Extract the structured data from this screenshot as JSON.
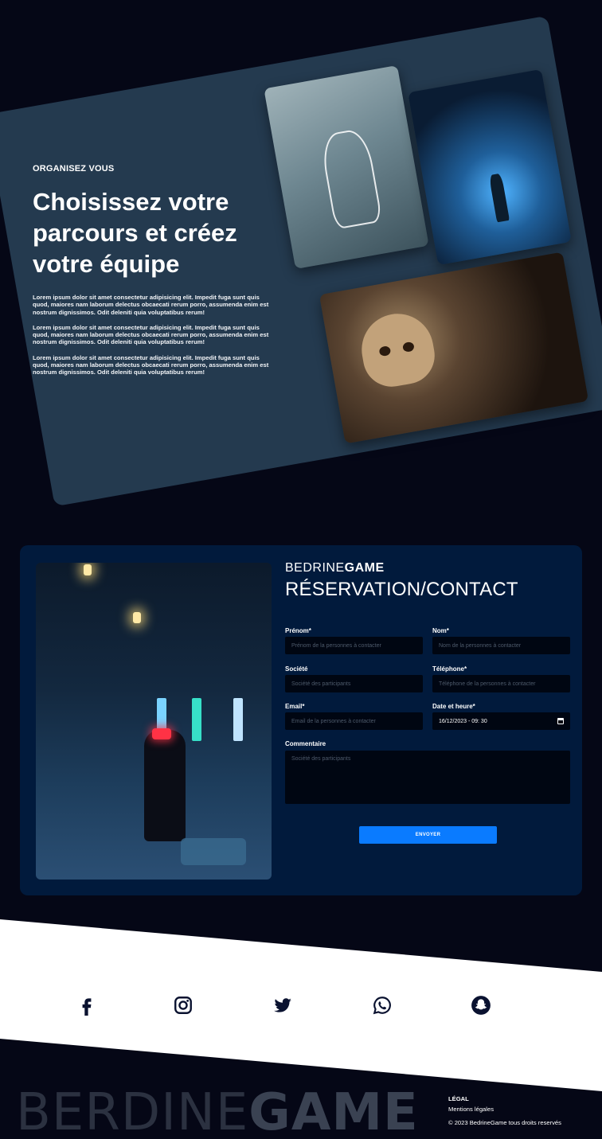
{
  "hero": {
    "eyebrow": "ORGANISEZ VOUS",
    "title": "Choisissez votre parcours et créez votre équipe",
    "paragraphs": [
      "Lorem ipsum dolor sit amet consectetur adipisicing elit. Impedit fuga sunt quis quod, maiores nam laborum delectus obcaecati rerum porro, assumenda enim est nostrum dignissimos. Odit deleniti quia voluptatibus rerum!",
      "Lorem ipsum dolor sit amet consectetur adipisicing elit. Impedit fuga sunt quis quod, maiores nam laborum delectus obcaecati rerum porro, assumenda enim est nostrum dignissimos. Odit deleniti quia voluptatibus rerum!",
      "Lorem ipsum dolor sit amet consectetur adipisicing elit. Impedit fuga sunt quis quod, maiores nam laborum delectus obcaecati rerum porro, assumenda enim est nostrum dignissimos. Odit deleniti quia voluptatibus rerum!"
    ]
  },
  "reservation": {
    "brand_light": "BEDRINE",
    "brand_bold": "GAME",
    "title": "RÉSERVATION/CONTACT",
    "fields": {
      "prenom": {
        "label": "Prénom*",
        "placeholder": "Prénom de la personnes à contacter"
      },
      "nom": {
        "label": "Nom*",
        "placeholder": "Nom de la personnes à contacter"
      },
      "societe": {
        "label": "Société",
        "placeholder": "Société des participants"
      },
      "telephone": {
        "label": "Téléphone*",
        "placeholder": "Téléphone de la personnes à contacter"
      },
      "email": {
        "label": "Email*",
        "placeholder": "Email de la personnes à contacter"
      },
      "date": {
        "label": "Date et heure*",
        "value": "16/12/2023 -  09: 30"
      },
      "commentaire": {
        "label": "Commentaire",
        "placeholder": "Société des participants"
      }
    },
    "submit_label": "ENVOYER"
  },
  "social": {
    "icons": [
      "facebook-icon",
      "instagram-icon",
      "twitter-icon",
      "whatsapp-icon",
      "snapchat-icon"
    ]
  },
  "footer": {
    "brand_light": "BERDINE",
    "brand_bold": "GAME",
    "legal_heading": "LÉGAL",
    "legal_link": "Mentions légales",
    "copyright": "© 2023 BedrineGame tous droits reservés"
  },
  "colors": {
    "page_bg": "#050716",
    "hero_card": "#243a4f",
    "reservation_bg": "#011a3c",
    "input_bg": "#000612",
    "button": "#0a7bff",
    "social_icon": "#0a1230"
  }
}
